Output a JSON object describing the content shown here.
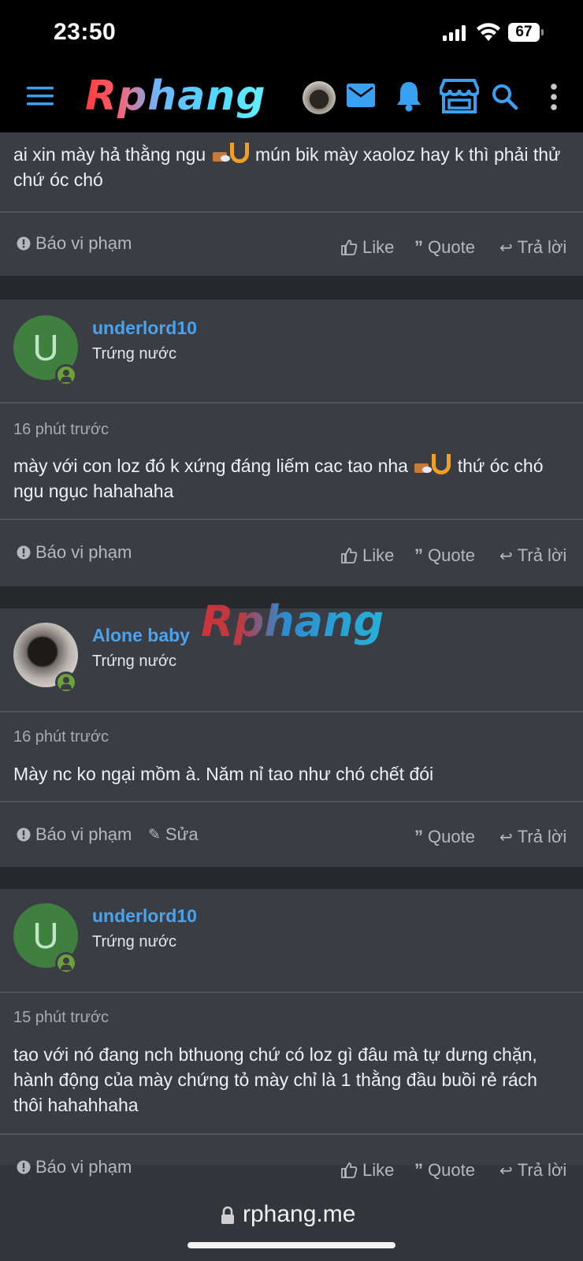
{
  "status_bar": {
    "time": "23:50",
    "battery": "67"
  },
  "nav": {
    "logo": "Rphang",
    "icons": [
      "menu-icon",
      "avatar",
      "mail-icon",
      "bell-icon",
      "store-icon",
      "search-icon",
      "more-vertical-icon"
    ]
  },
  "actions": {
    "report": "Báo vi phạm",
    "like": "Like",
    "quote": "Quote",
    "reply": "Trả lời",
    "edit": "Sửa"
  },
  "posts": [
    {
      "body_before_emoji": "ai xin mày hả thằng ngu",
      "body_after_emoji": "mún bik mày xaoloz hay k thì phải thử chứ óc chó"
    },
    {
      "avatar_letter": "U",
      "username": "underlord10",
      "rank": "Trứng nước",
      "time": "16 phút trước",
      "body_before_emoji": "mày với con loz đó k xứng đáng liếm cac tao nha",
      "body_after_emoji": "thứ óc chó ngu ngục hahahaha"
    },
    {
      "username": "Alone baby",
      "rank": "Trứng nước",
      "time": "16 phút trước",
      "body": "Mày nc ko ngại mồm à. Năm nỉ tao như chó chết đói"
    },
    {
      "avatar_letter": "U",
      "username": "underlord10",
      "rank": "Trứng nước",
      "time": "15 phút trước",
      "body": "tao với nó đang nch bthuong chứ có loz gì đâu mà tự dưng chặn, hành động của mày chứng tỏ mày chỉ là 1 thằng đầu buồi rẻ rách thôi hahahhaha"
    }
  ],
  "watermark": "Rphang",
  "url_bar": {
    "url": "rphang.me"
  },
  "colors": {
    "accent": "#4aa3ee",
    "online": "#6ca13c",
    "background": "#3a3d44"
  }
}
